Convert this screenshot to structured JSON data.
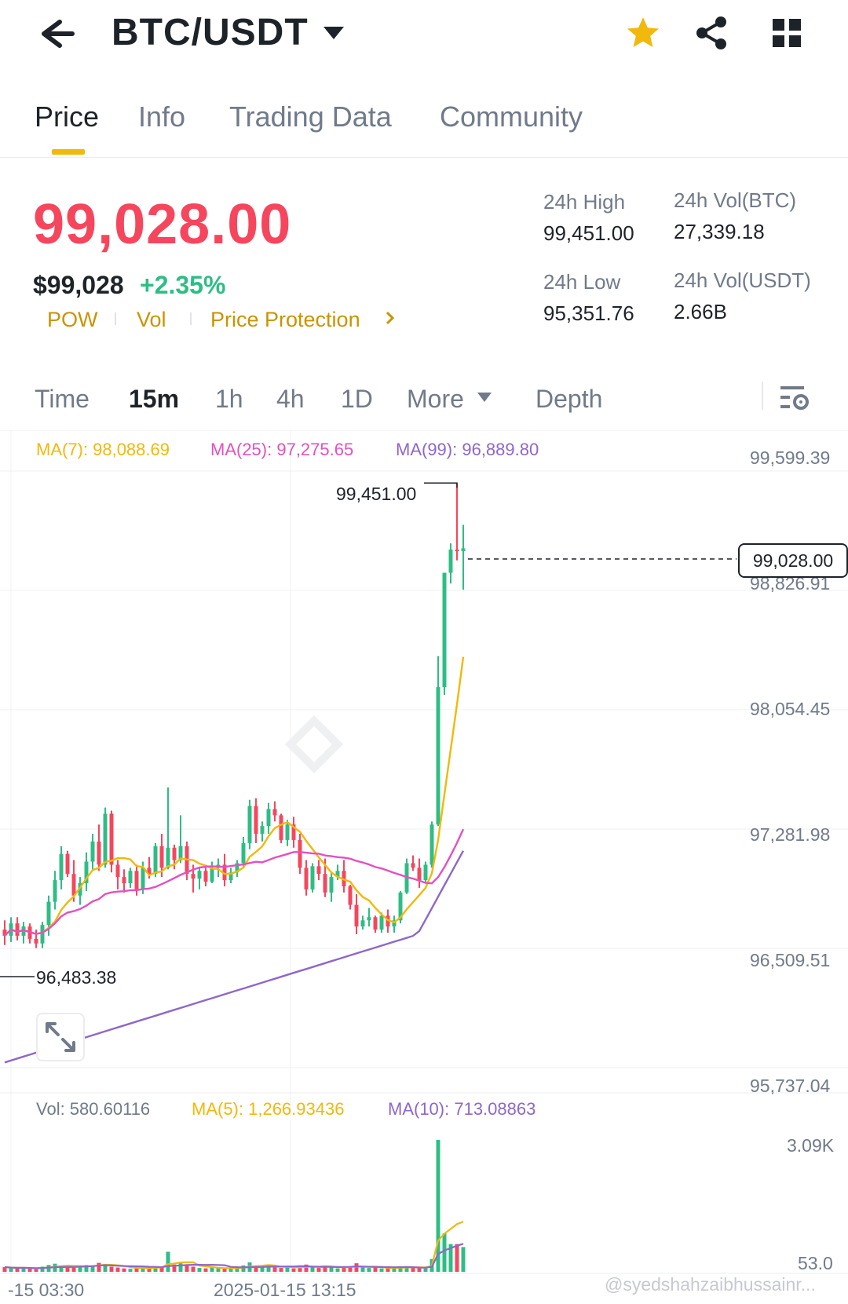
{
  "header": {
    "pair": "BTC/USDT",
    "icons": [
      "back-arrow-icon",
      "caret-down-icon",
      "star-icon",
      "share-icon",
      "grid-menu-icon"
    ],
    "favorite_color": "#f0b90b"
  },
  "tabs": [
    {
      "label": "Price",
      "active": true
    },
    {
      "label": "Info",
      "active": false
    },
    {
      "label": "Trading Data",
      "active": false
    },
    {
      "label": "Community",
      "active": false
    }
  ],
  "price": {
    "last": "99,028.00",
    "usd": "$99,028",
    "change_pct": "+2.35%",
    "tags": [
      "POW",
      "Vol",
      "Price Protection"
    ],
    "up_color": "#2ebd85",
    "down_color": "#f6465d"
  },
  "stats": {
    "high_label": "24h High",
    "high_value": "99,451.00",
    "vol_btc_label": "24h Vol(BTC)",
    "vol_btc_value": "27,339.18",
    "low_label": "24h Low",
    "low_value": "95,351.76",
    "vol_usdt_label": "24h Vol(USDT)",
    "vol_usdt_value": "2.66B"
  },
  "intervals": [
    {
      "label": "Time",
      "active": false
    },
    {
      "label": "15m",
      "active": true
    },
    {
      "label": "1h",
      "active": false
    },
    {
      "label": "4h",
      "active": false
    },
    {
      "label": "1D",
      "active": false
    },
    {
      "label": "More",
      "active": false
    },
    {
      "label": "Depth",
      "active": false
    }
  ],
  "chart_data": {
    "type": "candlestick",
    "interval": "15m",
    "ma_legend": {
      "ma7": "MA(7): 98,088.69",
      "ma25": "MA(25): 97,275.65",
      "ma99": "MA(99): 96,889.80"
    },
    "ma_colors": {
      "ma7": "#f0b90b",
      "ma25": "#e251c0",
      "ma99": "#8e67c8"
    },
    "y_ticks": [
      "99,599.39",
      "98,826.91",
      "98,054.45",
      "97,281.98",
      "96,509.51",
      "95,737.04"
    ],
    "y_tick_values": [
      99599.39,
      98826.91,
      98054.45,
      97281.98,
      96509.51,
      95737.04
    ],
    "high_marker": "99,451.00",
    "low_marker": "96,483.38",
    "last_price_tag": "99,028.00",
    "x_ticks": [
      "-15 03:30",
      "2025-01-15 13:15"
    ],
    "candles": [
      [
        96560,
        96620,
        96460,
        96520
      ],
      [
        96520,
        96640,
        96480,
        96600
      ],
      [
        96600,
        96640,
        96490,
        96520
      ],
      [
        96520,
        96610,
        96470,
        96580
      ],
      [
        96580,
        96600,
        96470,
        96500
      ],
      [
        96500,
        96560,
        96440,
        96470
      ],
      [
        96470,
        96610,
        96440,
        96590
      ],
      [
        96590,
        96780,
        96520,
        96740
      ],
      [
        96740,
        96940,
        96690,
        96880
      ],
      [
        96880,
        97100,
        96820,
        97050
      ],
      [
        97050,
        97070,
        96900,
        96920
      ],
      [
        96920,
        97010,
        96740,
        96780
      ],
      [
        96780,
        96900,
        96720,
        96860
      ],
      [
        96860,
        97060,
        96810,
        97000
      ],
      [
        97000,
        97180,
        96940,
        97130
      ],
      [
        97130,
        97240,
        96940,
        96980
      ],
      [
        96980,
        97350,
        96960,
        97310
      ],
      [
        97310,
        97330,
        96930,
        96980
      ],
      [
        96980,
        97010,
        96820,
        96900
      ],
      [
        96900,
        96950,
        96800,
        96860
      ],
      [
        96860,
        96960,
        96830,
        96940
      ],
      [
        96940,
        96980,
        96780,
        96820
      ],
      [
        96820,
        97000,
        96790,
        96960
      ],
      [
        96960,
        97030,
        96890,
        96920
      ],
      [
        96920,
        97120,
        96900,
        97100
      ],
      [
        97100,
        97180,
        96900,
        96960
      ],
      [
        96960,
        97480,
        96950,
        97090
      ],
      [
        97090,
        97110,
        96950,
        97010
      ],
      [
        97010,
        97300,
        96990,
        97100
      ],
      [
        97100,
        97130,
        96880,
        96920
      ],
      [
        96920,
        96980,
        96800,
        96890
      ],
      [
        96890,
        96960,
        96820,
        96940
      ],
      [
        96940,
        96960,
        96840,
        96870
      ],
      [
        96870,
        97000,
        96860,
        96960
      ],
      [
        96960,
        97020,
        96900,
        96980
      ],
      [
        96980,
        97050,
        96840,
        96880
      ],
      [
        96880,
        96960,
        96860,
        96930
      ],
      [
        96930,
        97010,
        96900,
        96990
      ],
      [
        96990,
        97160,
        96960,
        97120
      ],
      [
        97120,
        97400,
        97080,
        97360
      ],
      [
        97360,
        97410,
        97120,
        97180
      ],
      [
        97180,
        97260,
        97130,
        97230
      ],
      [
        97230,
        97380,
        97180,
        97340
      ],
      [
        97340,
        97390,
        97260,
        97300
      ],
      [
        97300,
        97310,
        97120,
        97140
      ],
      [
        97140,
        97270,
        97100,
        97240
      ],
      [
        97240,
        97290,
        97090,
        97140
      ],
      [
        97140,
        97180,
        96920,
        96960
      ],
      [
        96960,
        97010,
        96780,
        96820
      ],
      [
        96820,
        96990,
        96800,
        96970
      ],
      [
        96970,
        97010,
        96880,
        96920
      ],
      [
        96920,
        97020,
        96770,
        96800
      ],
      [
        96800,
        96930,
        96740,
        96900
      ],
      [
        96900,
        96980,
        96880,
        96940
      ],
      [
        96940,
        97010,
        96800,
        96840
      ],
      [
        96840,
        96850,
        96690,
        96720
      ],
      [
        96720,
        96790,
        96530,
        96580
      ],
      [
        96580,
        96650,
        96560,
        96620
      ],
      [
        96620,
        96700,
        96580,
        96640
      ],
      [
        96640,
        96650,
        96540,
        96560
      ],
      [
        96560,
        96670,
        96540,
        96650
      ],
      [
        96650,
        96690,
        96540,
        96580
      ],
      [
        96580,
        96650,
        96540,
        96620
      ],
      [
        96620,
        96810,
        96600,
        96800
      ],
      [
        96800,
        97020,
        96790,
        96990
      ],
      [
        96990,
        97040,
        96940,
        96960
      ],
      [
        96960,
        97020,
        96830,
        96880
      ],
      [
        96880,
        97000,
        96860,
        96980
      ],
      [
        96980,
        97260,
        96960,
        97240
      ],
      [
        97240,
        98330,
        97230,
        98130
      ],
      [
        98130,
        98820,
        98080,
        98870
      ],
      [
        98870,
        99060,
        98800,
        99020
      ],
      [
        99020,
        99451,
        98950,
        99010
      ],
      [
        99010,
        99180,
        98760,
        99028
      ]
    ],
    "volume_legend": {
      "vol": "Vol: 580.60116",
      "ma5": "MA(5): 1,266.93436",
      "ma10": "MA(10): 713.08863"
    },
    "volume_y_ticks": [
      "3.09K",
      "53.0"
    ],
    "volumes_k": [
      0.11,
      0.09,
      0.08,
      0.1,
      0.07,
      0.06,
      0.12,
      0.16,
      0.19,
      0.14,
      0.12,
      0.1,
      0.13,
      0.16,
      0.15,
      0.21,
      0.18,
      0.12,
      0.1,
      0.08,
      0.07,
      0.09,
      0.1,
      0.08,
      0.13,
      0.12,
      0.47,
      0.17,
      0.2,
      0.16,
      0.12,
      0.09,
      0.08,
      0.1,
      0.09,
      0.07,
      0.08,
      0.09,
      0.15,
      0.22,
      0.14,
      0.12,
      0.16,
      0.1,
      0.09,
      0.1,
      0.08,
      0.15,
      0.17,
      0.11,
      0.09,
      0.14,
      0.12,
      0.08,
      0.1,
      0.12,
      0.2,
      0.1,
      0.09,
      0.1,
      0.08,
      0.09,
      0.1,
      0.11,
      0.13,
      0.09,
      0.1,
      0.08,
      0.3,
      3.09,
      0.9,
      0.65,
      0.65,
      0.58
    ]
  },
  "watermark": "@syedshahzaibhussainr..."
}
